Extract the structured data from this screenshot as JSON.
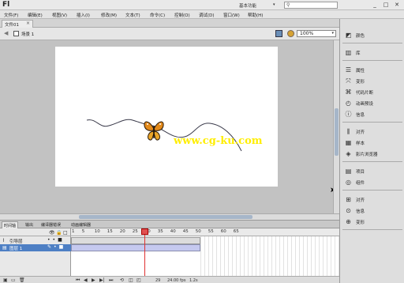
{
  "app": {
    "logo": "Fl",
    "workspace": "基本功能",
    "search_icon": "search-icon"
  },
  "window_controls": {
    "minimize": "_",
    "restore": "□",
    "close": "✕"
  },
  "menus": [
    "文件(F)",
    "编辑(E)",
    "视图(V)",
    "插入(I)",
    "修改(M)",
    "文本(T)",
    "命令(C)",
    "控制(O)",
    "调试(D)",
    "窗口(W)",
    "帮助(H)"
  ],
  "document": {
    "tab": "文件01",
    "tab_close": "×",
    "scene": "场景 1",
    "zoom": "100%"
  },
  "stage": {
    "watermark": "www.cg-ku.com",
    "background": "#ffffff",
    "path_color": "#3a3a4a"
  },
  "timeline": {
    "tabs": [
      "时间轴",
      "输出",
      "编译器错误",
      "动画编辑器"
    ],
    "layers": [
      {
        "name": "引导层",
        "kind": "guide"
      },
      {
        "name": "图层 1",
        "kind": "normal",
        "selected": true
      }
    ],
    "ruler_ticks": [
      "1",
      "5",
      "10",
      "15",
      "20",
      "25",
      "30",
      "35",
      "40",
      "45",
      "50",
      "55",
      "60",
      "65"
    ],
    "current_frame": "29",
    "fps": "24.00 fps",
    "time": "1.2s",
    "playhead_color": "#e03030"
  },
  "right_panel": {
    "groups": [
      [
        {
          "icon": "color-icon",
          "label": "颜色"
        }
      ],
      [
        {
          "icon": "library-icon",
          "label": "库"
        }
      ],
      [
        {
          "icon": "properties-icon",
          "label": "属性"
        },
        {
          "icon": "transform-icon",
          "label": "变形"
        },
        {
          "icon": "code-snippets-icon",
          "label": "代码片断"
        },
        {
          "icon": "motion-presets-icon",
          "label": "动画预设"
        },
        {
          "icon": "info-icon",
          "label": "信息"
        }
      ],
      [
        {
          "icon": "align-icon",
          "label": "对齐"
        },
        {
          "icon": "swatches-icon",
          "label": "样本"
        },
        {
          "icon": "components-icon",
          "label": "影片浏览器"
        }
      ],
      [
        {
          "icon": "project-icon",
          "label": "项目"
        },
        {
          "icon": "components2-icon",
          "label": "组件"
        }
      ],
      [
        {
          "icon": "align2-icon",
          "label": "对齐"
        },
        {
          "icon": "history-icon",
          "label": "信息"
        },
        {
          "icon": "transform2-icon",
          "label": "变形"
        }
      ]
    ]
  }
}
